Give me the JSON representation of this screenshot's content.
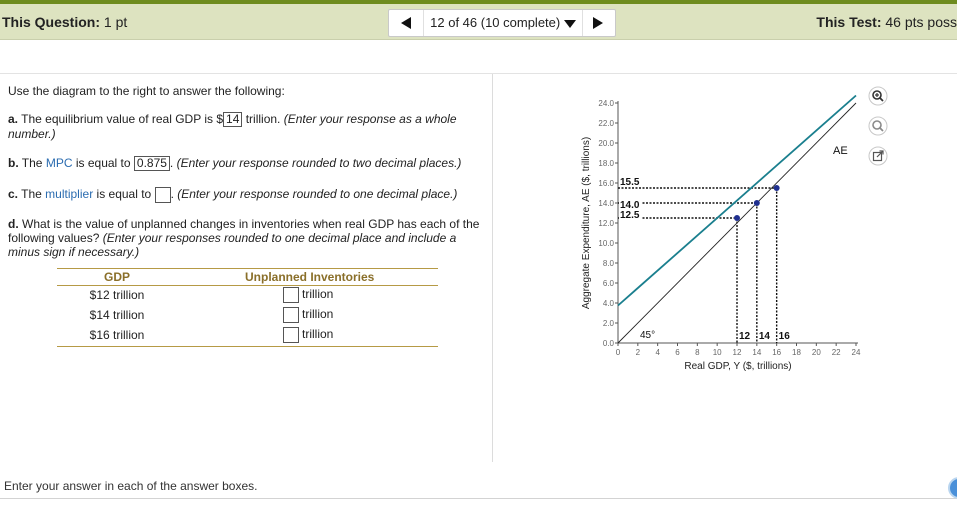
{
  "header": {
    "question_label": "This Question:",
    "question_points": "1 pt",
    "nav_text": "12 of 46 (10 complete)",
    "test_label": "This Test:",
    "test_points": "46 pts poss"
  },
  "question": {
    "intro": "Use the diagram to the right to answer the  following:",
    "a_label": "a.",
    "a_text": "The equilibrium value of real GDP is $",
    "a_answer": "14",
    "a_after": "trillion.",
    "a_hint": "(Enter your response as a whole number.)",
    "b_label": "b.",
    "b_text_pre": "The",
    "b_mpc": "MPC",
    "b_text_post": "is equal to",
    "b_answer": "0.875",
    "b_hint": "(Enter your response rounded to two decimal places.)",
    "c_label": "c.",
    "c_text_pre": "The",
    "c_mult": "multiplier",
    "c_text_post": "is equal to",
    "c_hint": "(Enter your response rounded to one decimal place.)",
    "d_label": "d.",
    "d_text": "What is the value of unplanned changes in inventories when real GDP has each of the following values?",
    "d_hint": "(Enter your responses rounded to one decimal place and include a minus sign if necessary.)"
  },
  "table": {
    "col_gdp": "GDP",
    "col_ui": "Unplanned Inventories",
    "unit": "trillion",
    "rows": [
      "$12 trillion",
      "$14 trillion",
      "$16 trillion"
    ]
  },
  "footer": {
    "instruction": "Enter your answer in each of the answer boxes."
  },
  "tools": [
    "zoom-in-icon",
    "zoom-out-icon",
    "popout-icon"
  ],
  "colors": {
    "accent_bar": "#6e8c1e",
    "header_bg": "#dde3c0",
    "ae_line": "#1a7f8e",
    "points": "#1f2f8f",
    "table_rule": "#b69a45"
  },
  "chart_data": {
    "type": "line",
    "ylabel": "Aggregate Expenditure, AE ($, trillions)",
    "xlabel": "Real GDP, Y ($, trillions)",
    "xlim": [
      0,
      24
    ],
    "ylim": [
      0,
      24
    ],
    "x_ticks": [
      "0",
      "2",
      "4",
      "6",
      "8",
      "10",
      "12",
      "14",
      "16",
      "18",
      "20",
      "22",
      "24"
    ],
    "y_ticks": [
      "0.0",
      "2.0",
      "4.0",
      "6.0",
      "8.0",
      "10.0",
      "12.0",
      "14.0",
      "16.0",
      "18.0",
      "20.0",
      "22.0",
      "24.0"
    ],
    "series": [
      {
        "name": "45°",
        "x": [
          0,
          24
        ],
        "y": [
          0,
          24
        ]
      },
      {
        "name": "AE",
        "x": [
          0,
          24
        ],
        "y": [
          3.75,
          24.75
        ]
      }
    ],
    "points": [
      {
        "x": 12,
        "y": 12.5
      },
      {
        "x": 14,
        "y": 14.0
      },
      {
        "x": 16,
        "y": 15.5
      }
    ],
    "y_annotations": [
      "15.5",
      "14.0",
      "12.5"
    ],
    "x_annotations": [
      "12",
      "14",
      "16"
    ],
    "line_labels": {
      "ae": "AE",
      "diag": "45°"
    }
  }
}
